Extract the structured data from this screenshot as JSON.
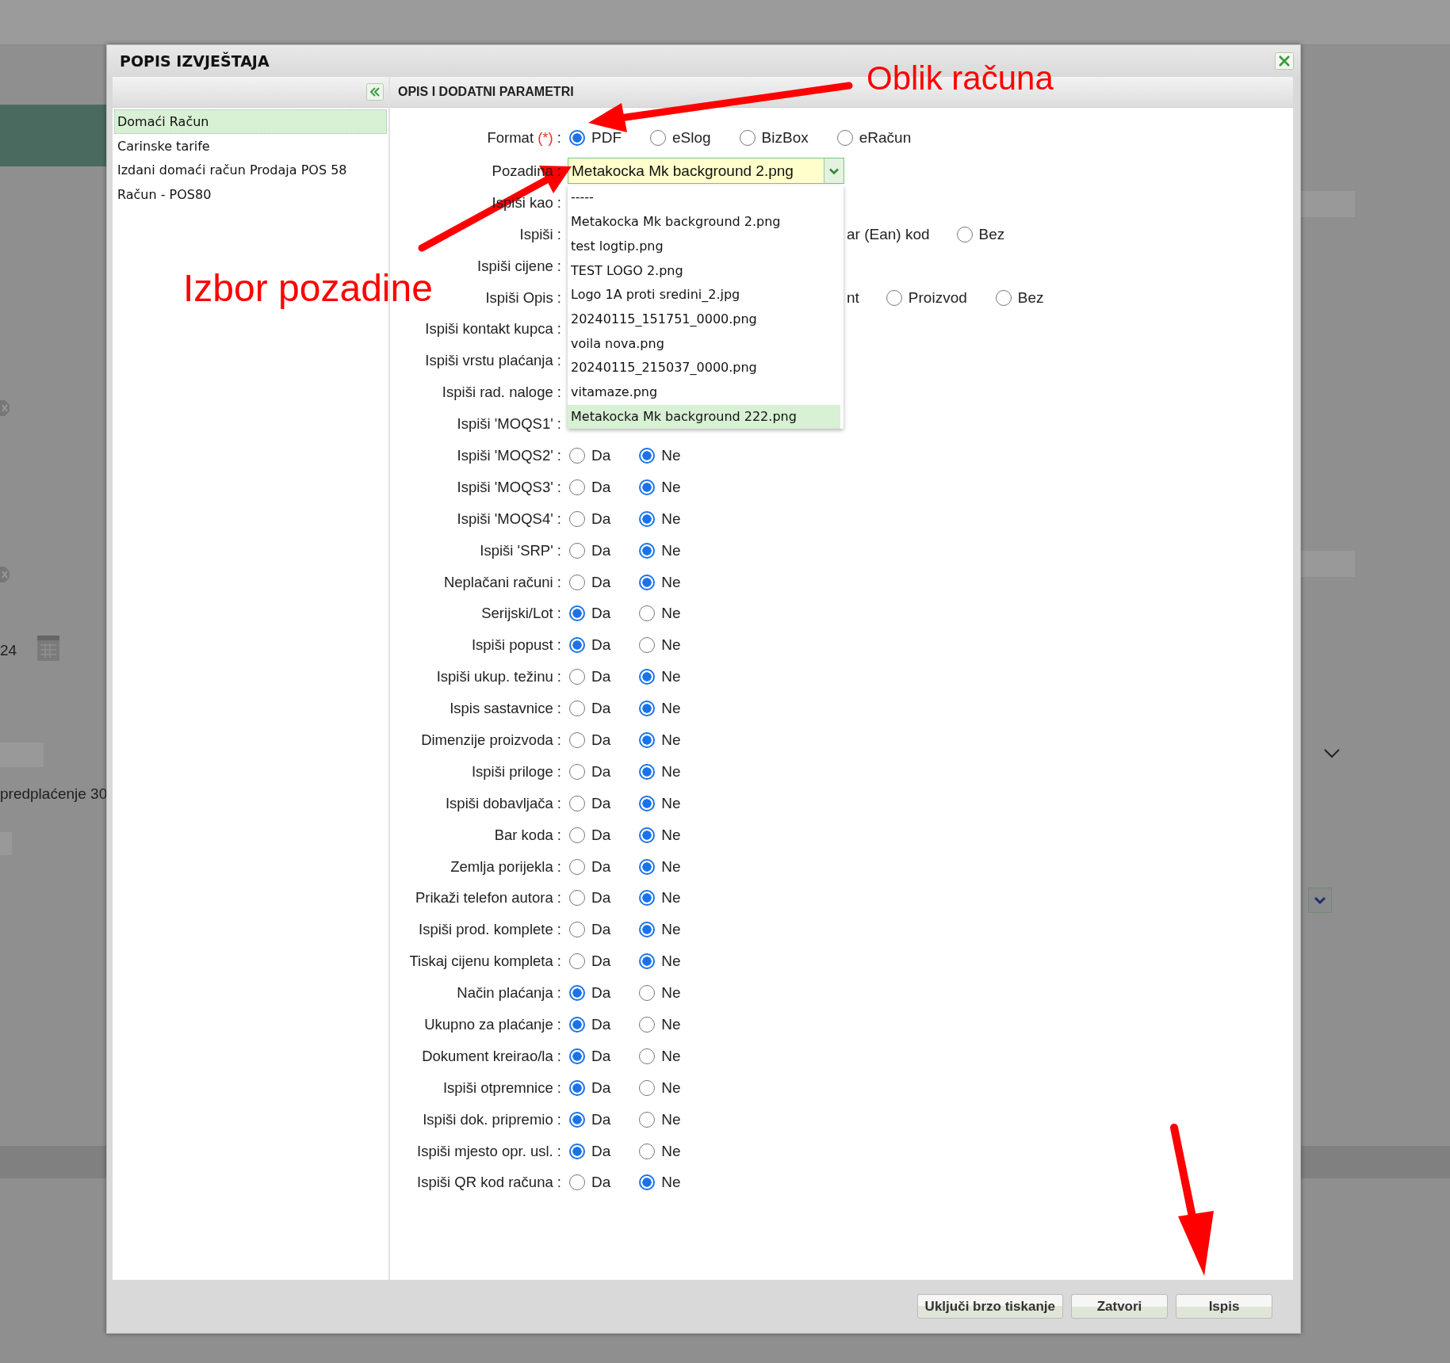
{
  "background": {
    "texts": [
      "24",
      "predplaćenje 30"
    ]
  },
  "dialog": {
    "title": "POPIS IZVJEŠTAJA"
  },
  "sidebar": {
    "items": [
      {
        "label": "Domaći Račun",
        "selected": true
      },
      {
        "label": "Carinske tarife",
        "selected": false
      },
      {
        "label": "Izdani domaći račun Prodaja POS 58",
        "selected": false
      },
      {
        "label": "Račun - POS80",
        "selected": false
      }
    ]
  },
  "panel": {
    "title": "OPIS I DODATNI PARAMETRI"
  },
  "rows": [
    {
      "kind": "radio",
      "label": "Format",
      "required_mark": "(*)",
      "label_end": ":",
      "options": [
        {
          "label": "PDF",
          "selected": true
        },
        {
          "label": "eSlog",
          "selected": false
        },
        {
          "label": "BizBox",
          "selected": false
        },
        {
          "label": "eRačun",
          "selected": false
        }
      ]
    },
    {
      "kind": "select",
      "label": "Pozadina :",
      "value": "Metakocka Mk background 2.png",
      "expanded": true,
      "list": [
        {
          "label": "-----",
          "highlighted": false
        },
        {
          "label": "Metakocka Mk background 2.png",
          "highlighted": false
        },
        {
          "label": "test logtip.png",
          "highlighted": false
        },
        {
          "label": "TEST LOGO 2.png",
          "highlighted": false
        },
        {
          "label": "Logo 1A proti sredini_2.jpg",
          "highlighted": false
        },
        {
          "label": "20240115_151751_0000.png",
          "highlighted": false
        },
        {
          "label": "voila nova.png",
          "highlighted": false
        },
        {
          "label": "20240115_215037_0000.png",
          "highlighted": false
        },
        {
          "label": "vitamaze.png",
          "highlighted": false
        },
        {
          "label": "Metakocka Mk background 222.png",
          "highlighted": true
        }
      ]
    },
    {
      "kind": "covered",
      "label": "Ispiši kao :"
    },
    {
      "kind": "partial",
      "label": "Ispiši :",
      "fragment": "ar (Ean) kod",
      "options": [
        {
          "label": "Bez",
          "selected": false
        }
      ]
    },
    {
      "kind": "covered",
      "label": "Ispiši cijene :"
    },
    {
      "kind": "partial",
      "label": "Ispiši Opis :",
      "fragment": "nt",
      "options": [
        {
          "label": "Proizvod",
          "selected": false
        },
        {
          "label": "Bez",
          "selected": false
        }
      ]
    },
    {
      "kind": "covered",
      "label": "Ispiši kontakt kupca :"
    },
    {
      "kind": "covered",
      "label": "Ispiši vrstu plaćanja :"
    },
    {
      "kind": "covered",
      "label": "Ispiši rad. naloge :"
    },
    {
      "kind": "covered",
      "label": "Ispiši 'MOQS1' :"
    },
    {
      "kind": "radio",
      "label": "Ispiši 'MOQS2' :",
      "options": [
        {
          "label": "Da",
          "selected": false
        },
        {
          "label": "Ne",
          "selected": true
        }
      ]
    },
    {
      "kind": "radio",
      "label": "Ispiši 'MOQS3' :",
      "options": [
        {
          "label": "Da",
          "selected": false
        },
        {
          "label": "Ne",
          "selected": true
        }
      ]
    },
    {
      "kind": "radio",
      "label": "Ispiši 'MOQS4' :",
      "options": [
        {
          "label": "Da",
          "selected": false
        },
        {
          "label": "Ne",
          "selected": true
        }
      ]
    },
    {
      "kind": "radio",
      "label": "Ispiši 'SRP' :",
      "options": [
        {
          "label": "Da",
          "selected": false
        },
        {
          "label": "Ne",
          "selected": true
        }
      ]
    },
    {
      "kind": "radio",
      "label": "Neplačani računi :",
      "options": [
        {
          "label": "Da",
          "selected": false
        },
        {
          "label": "Ne",
          "selected": true
        }
      ]
    },
    {
      "kind": "radio",
      "label": "Serijski/Lot :",
      "options": [
        {
          "label": "Da",
          "selected": true
        },
        {
          "label": "Ne",
          "selected": false
        }
      ]
    },
    {
      "kind": "radio",
      "label": "Ispiši popust :",
      "options": [
        {
          "label": "Da",
          "selected": true
        },
        {
          "label": "Ne",
          "selected": false
        }
      ]
    },
    {
      "kind": "radio",
      "label": "Ispiši ukup. težinu :",
      "options": [
        {
          "label": "Da",
          "selected": false
        },
        {
          "label": "Ne",
          "selected": true
        }
      ]
    },
    {
      "kind": "radio",
      "label": "Ispis sastavnice :",
      "options": [
        {
          "label": "Da",
          "selected": false
        },
        {
          "label": "Ne",
          "selected": true
        }
      ]
    },
    {
      "kind": "radio",
      "label": "Dimenzije proizvoda :",
      "options": [
        {
          "label": "Da",
          "selected": false
        },
        {
          "label": "Ne",
          "selected": true
        }
      ]
    },
    {
      "kind": "radio",
      "label": "Ispiši priloge :",
      "options": [
        {
          "label": "Da",
          "selected": false
        },
        {
          "label": "Ne",
          "selected": true
        }
      ]
    },
    {
      "kind": "radio",
      "label": "Ispiši dobavljača :",
      "options": [
        {
          "label": "Da",
          "selected": false
        },
        {
          "label": "Ne",
          "selected": true
        }
      ]
    },
    {
      "kind": "radio",
      "label": "Bar koda :",
      "options": [
        {
          "label": "Da",
          "selected": false
        },
        {
          "label": "Ne",
          "selected": true
        }
      ]
    },
    {
      "kind": "radio",
      "label": "Zemlja porijekla :",
      "options": [
        {
          "label": "Da",
          "selected": false
        },
        {
          "label": "Ne",
          "selected": true
        }
      ]
    },
    {
      "kind": "radio",
      "label": "Prikaži telefon autora :",
      "options": [
        {
          "label": "Da",
          "selected": false
        },
        {
          "label": "Ne",
          "selected": true
        }
      ]
    },
    {
      "kind": "radio",
      "label": "Ispiši prod. komplete :",
      "options": [
        {
          "label": "Da",
          "selected": false
        },
        {
          "label": "Ne",
          "selected": true
        }
      ]
    },
    {
      "kind": "radio",
      "label": "Tiskaj cijenu kompleta :",
      "options": [
        {
          "label": "Da",
          "selected": false
        },
        {
          "label": "Ne",
          "selected": true
        }
      ]
    },
    {
      "kind": "radio",
      "label": "Način plaćanja :",
      "options": [
        {
          "label": "Da",
          "selected": true
        },
        {
          "label": "Ne",
          "selected": false
        }
      ]
    },
    {
      "kind": "radio",
      "label": "Ukupno za plaćanje :",
      "options": [
        {
          "label": "Da",
          "selected": true
        },
        {
          "label": "Ne",
          "selected": false
        }
      ]
    },
    {
      "kind": "radio",
      "label": "Dokument kreirao/la :",
      "options": [
        {
          "label": "Da",
          "selected": true
        },
        {
          "label": "Ne",
          "selected": false
        }
      ]
    },
    {
      "kind": "radio",
      "label": "Ispiši otpremnice :",
      "options": [
        {
          "label": "Da",
          "selected": true
        },
        {
          "label": "Ne",
          "selected": false
        }
      ]
    },
    {
      "kind": "radio",
      "label": "Ispiši dok. pripremio :",
      "options": [
        {
          "label": "Da",
          "selected": true
        },
        {
          "label": "Ne",
          "selected": false
        }
      ]
    },
    {
      "kind": "radio",
      "label": "Ispiši mjesto opr. usl. :",
      "options": [
        {
          "label": "Da",
          "selected": true
        },
        {
          "label": "Ne",
          "selected": false
        }
      ]
    },
    {
      "kind": "radio",
      "label": "Ispiši QR kod računa :",
      "options": [
        {
          "label": "Da",
          "selected": false
        },
        {
          "label": "Ne",
          "selected": true
        }
      ]
    }
  ],
  "buttons": [
    "Uključi brzo tiskanje",
    "Zatvori",
    "Ispis"
  ],
  "annotations": [
    {
      "text": "Oblik računa"
    },
    {
      "text": "Izbor pozadine"
    }
  ]
}
